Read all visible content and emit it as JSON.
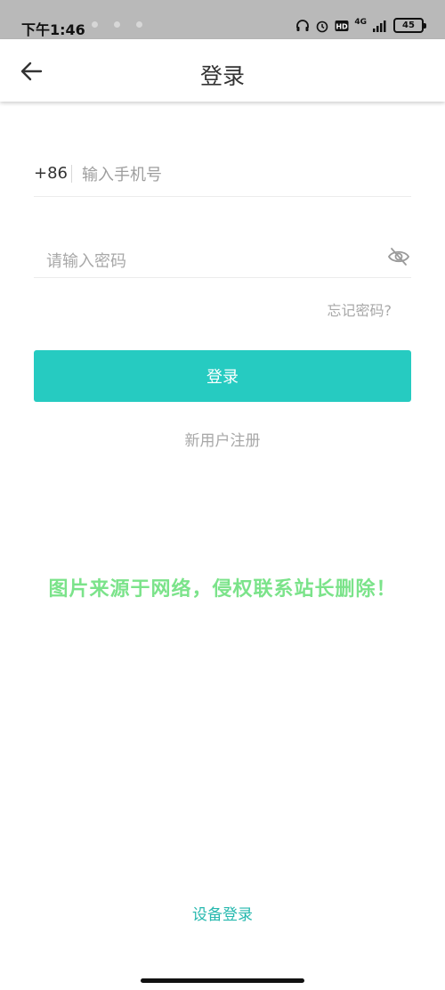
{
  "status_bar": {
    "time": "下午1:46",
    "network": "4G",
    "battery": "45"
  },
  "header": {
    "title": "登录"
  },
  "form": {
    "country_code": "+86",
    "phone_placeholder": "输入手机号",
    "password_placeholder": "请输入密码",
    "forgot_password": "忘记密码?",
    "login_button": "登录",
    "register_link": "新用户注册"
  },
  "watermark": "图片来源于网络，侵权联系站长删除！",
  "footer": {
    "device_login": "设备登录"
  },
  "colors": {
    "accent": "#26cbc1",
    "status_bar_bg": "#b9b9b9",
    "watermark": "#7be38a"
  },
  "icons": {
    "back": "arrow-left-icon",
    "password_visibility": "eye-off-icon"
  }
}
